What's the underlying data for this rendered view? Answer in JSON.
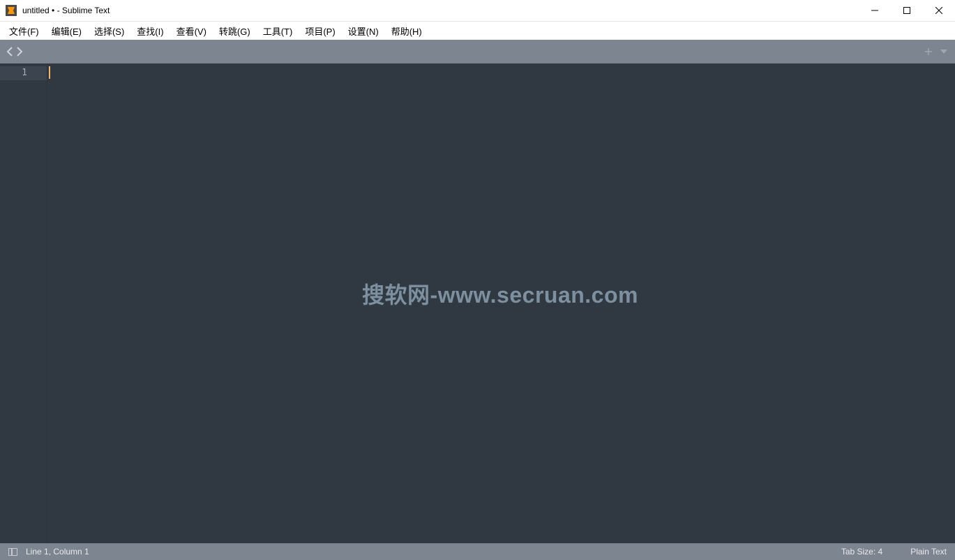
{
  "titlebar": {
    "title": "untitled • - Sublime Text"
  },
  "menubar": {
    "items": [
      "文件(F)",
      "编辑(E)",
      "选择(S)",
      "查找(I)",
      "查看(V)",
      "转跳(G)",
      "工具(T)",
      "项目(P)",
      "设置(N)",
      "帮助(H)"
    ]
  },
  "editor": {
    "line_numbers": [
      "1"
    ],
    "watermark": "搜软网-www.secruan.com"
  },
  "statusbar": {
    "position": "Line 1, Column 1",
    "tab_size": "Tab Size: 4",
    "syntax": "Plain Text"
  }
}
